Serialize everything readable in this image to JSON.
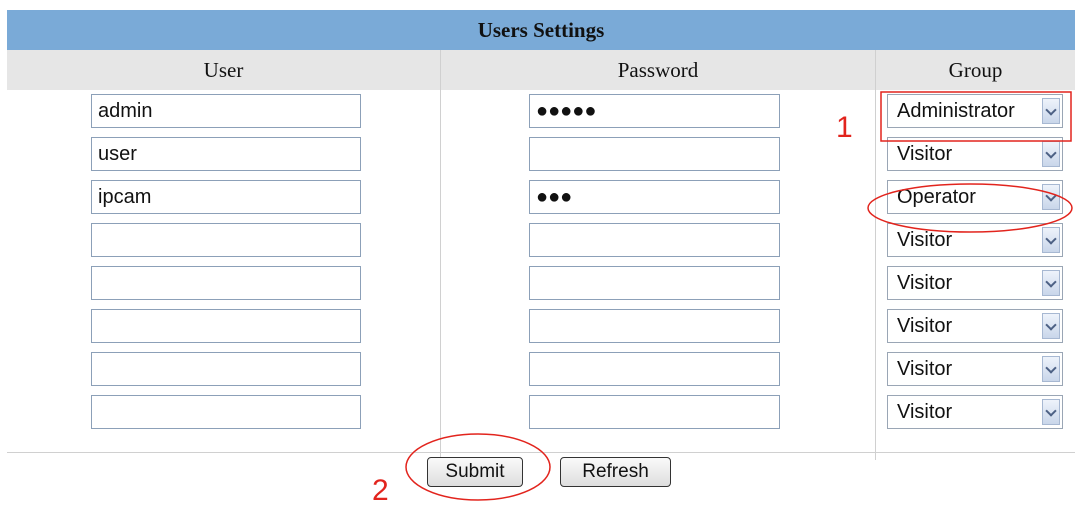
{
  "panel": {
    "title": "Users Settings"
  },
  "columns": {
    "user": "User",
    "password": "Password",
    "group": "Group"
  },
  "rows": [
    {
      "user": "admin",
      "password": "●●●●●",
      "group": "Administrator"
    },
    {
      "user": "user",
      "password": "",
      "group": "Visitor"
    },
    {
      "user": "ipcam",
      "password": "●●●",
      "group": "Operator"
    },
    {
      "user": "",
      "password": "",
      "group": "Visitor"
    },
    {
      "user": "",
      "password": "",
      "group": "Visitor"
    },
    {
      "user": "",
      "password": "",
      "group": "Visitor"
    },
    {
      "user": "",
      "password": "",
      "group": "Visitor"
    },
    {
      "user": "",
      "password": "",
      "group": "Visitor"
    }
  ],
  "buttons": {
    "submit": "Submit",
    "refresh": "Refresh"
  },
  "annotations": {
    "marker_1": "1",
    "marker_2": "2",
    "color": "#e2241d"
  },
  "colors": {
    "title_bar": "#7aaad7",
    "header_bg": "#e6e6e6"
  }
}
